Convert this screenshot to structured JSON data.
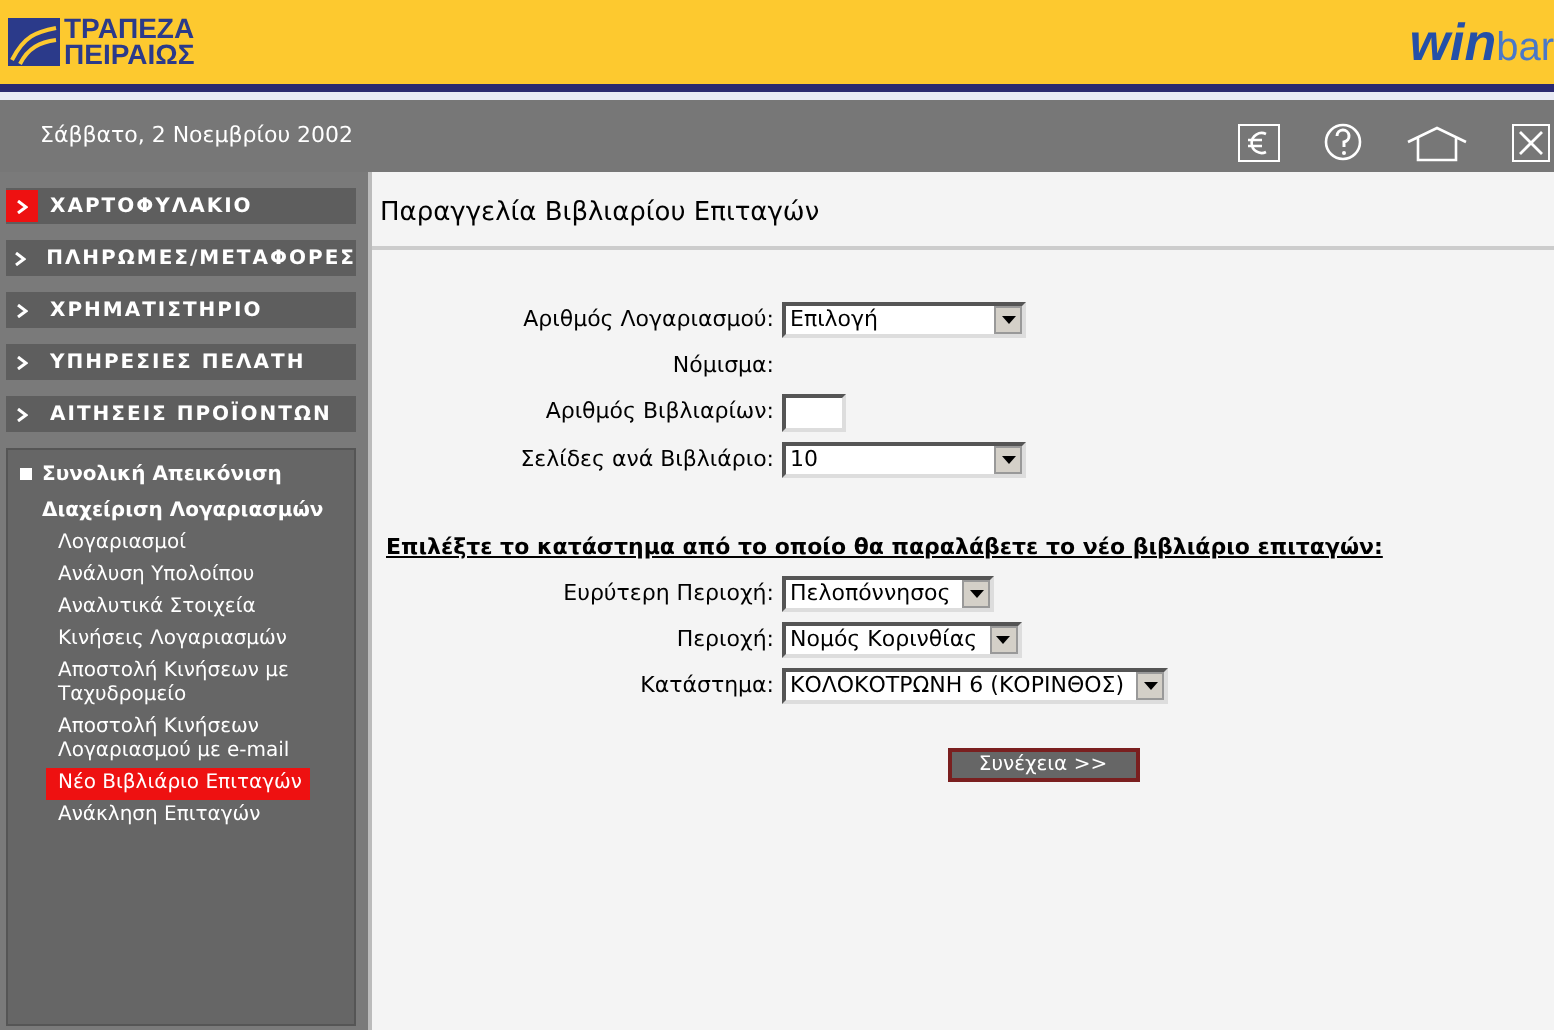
{
  "header": {
    "bank_logo": [
      "ΤΡΑΠΕΖΑ",
      "ΠΕΙΡΑΙΩΣ"
    ],
    "brand_logo": {
      "bold": "win",
      "light": "bar"
    }
  },
  "top_bar": {
    "date": "Σάββατο, 2 Νοεμβρίου 2002"
  },
  "menu": [
    {
      "label": "ΧΑΡΤΟΦΥΛΑΚΙΟ",
      "selected": true
    },
    {
      "label": "ΠΛΗΡΩΜΕΣ/ΜΕΤΑΦΟΡΕΣ",
      "selected": false
    },
    {
      "label": "ΧΡΗΜΑΤΙΣΤΗΡΙΟ",
      "selected": false
    },
    {
      "label": "ΥΠΗΡΕΣΙΕΣ ΠΕΛΑΤΗ",
      "selected": false
    },
    {
      "label": "ΑΙΤΗΣΕΙΣ ΠΡΟΪΟΝΤΩΝ",
      "selected": false
    }
  ],
  "submenu": [
    {
      "kind": "heading",
      "label": "Συνολική Απεικόνιση",
      "selected": false
    },
    {
      "kind": "group",
      "label": "Διαχείριση Λογαριασμών",
      "selected": false
    },
    {
      "kind": "link",
      "label": "Λογαριασμοί",
      "selected": false
    },
    {
      "kind": "link",
      "label": "Ανάλυση Υπολοίπου",
      "selected": false
    },
    {
      "kind": "link",
      "label": "Αναλυτικά Στοιχεία",
      "selected": false
    },
    {
      "kind": "link",
      "label": "Κινήσεις Λογαριασμών",
      "selected": false
    },
    {
      "kind": "link",
      "label": "Αποστολή Κινήσεων με Ταχυδρομείο",
      "selected": false
    },
    {
      "kind": "link",
      "label": "Αποστολή Κινήσεων Λογαριασμού με e-mail",
      "selected": false
    },
    {
      "kind": "link",
      "label": "Νέο Βιβλιάριο Επιταγών",
      "selected": true
    },
    {
      "kind": "link",
      "label": "Ανάκληση Επιταγών",
      "selected": false
    }
  ],
  "page_title": "Παραγγελία Βιβλιαρίου Επιταγών",
  "fields": [
    {
      "kind": "select",
      "label": "Αριθμός Λογαριασμού:",
      "value": "Επιλογή"
    },
    {
      "kind": "static",
      "label": "Νόμισμα:"
    },
    {
      "kind": "text",
      "label": "Αριθμός Βιβλιαρίων:"
    },
    {
      "kind": "select",
      "label": "Σελίδες ανά Βιβλιάριο:",
      "value": "10"
    }
  ],
  "store_heading": "Επιλέξτε το κατάστημα από το οποίο θα παραλάβετε το νέο βιβλιάριο επιταγών:",
  "store_fields": [
    {
      "kind": "select",
      "label": "Ευρύτερη Περιοχή:",
      "value": "Πελοπόννησος"
    },
    {
      "kind": "select",
      "label": "Περιοχή:",
      "value": "Νομός Κορινθίας"
    },
    {
      "kind": "select",
      "label": "Κατάστημα:",
      "value": "ΚΟΛΟΚΟΤΡΩΝΗ 6 (ΚΟΡΙΝΘΟΣ)"
    }
  ],
  "continue_button": "Συνέχεια >>"
}
